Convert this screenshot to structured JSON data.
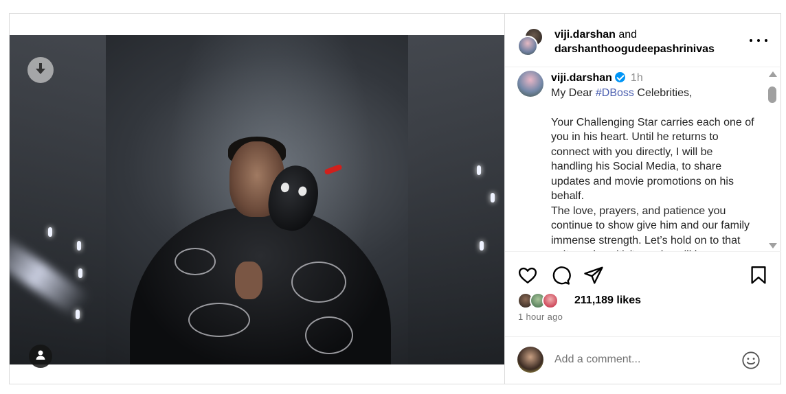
{
  "post": {
    "header": {
      "user1": "viji.darshan",
      "connector": " and",
      "user2": "darshanthoogudeepashrinivas"
    },
    "caption": {
      "username": "viji.darshan",
      "time": "1h",
      "line1_prefix": "My Dear ",
      "hashtag": "#DBoss",
      "line1_suffix": " Celebrities,",
      "para2": "Your Challenging Star carries each one of you in his heart. Until he returns to connect with you directly, I will be handling his Social Media, to share updates and movie promotions on his behalf.",
      "para3": "The love, prayers, and patience you continue to show give him and our family immense strength. Let’s hold on to that unity and positivity, as he will be"
    },
    "likes": {
      "count_text": "211,189 likes"
    },
    "time_ago": "1 hour ago",
    "comment": {
      "placeholder": "Add a comment..."
    }
  },
  "icons": {
    "download": "download-icon",
    "user_tag": "user-tag-icon",
    "more": "more-options-icon",
    "verified": "verified-badge-icon",
    "like": "heart-icon",
    "comment": "comment-icon",
    "share": "share-icon",
    "save": "bookmark-icon",
    "emoji": "emoji-icon"
  },
  "colors": {
    "hashtag": "#4b5fb0",
    "verified": "#0095f6",
    "muted_text": "#737373",
    "border": "#dbdbdb"
  }
}
